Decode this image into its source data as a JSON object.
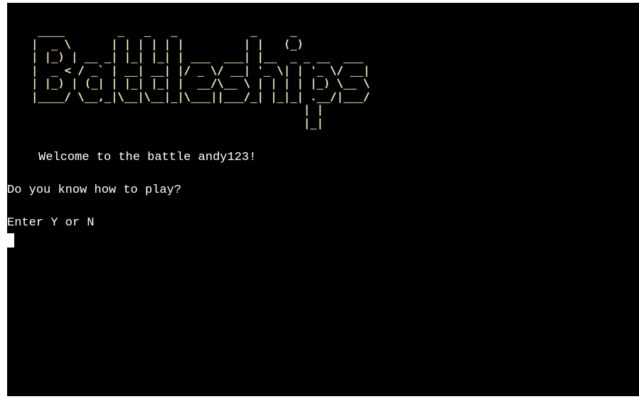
{
  "terminal": {
    "banner_lines": [
      " ____        _   _   _           _     _            ",
      "|  _ \\      | | | | | |         | |   (_)           ",
      "| |_) | __ _| |_| |_| | ___  ___| |__  _ _ __  ___ ",
      "|  _ < / _` | __| __| |/ _ \\/ __| '_ \\| | '_ \\/ __|",
      "| |_) | (_| | |_| |_| |  __/\\__ \\ | | | | |_) \\__ \\",
      "|____/ \\__,_|\\__|\\__|_|\\___||___/_| |_|_| .__/|___/",
      "                                         | |        ",
      "                                         |_|        "
    ],
    "welcome": "Welcome to the battle andy123!",
    "question": "Do you know how to play?",
    "prompt": "Enter Y or N",
    "banner_color": "#fff3c4",
    "text_color": "#ffffff",
    "background_color": "#000000"
  }
}
